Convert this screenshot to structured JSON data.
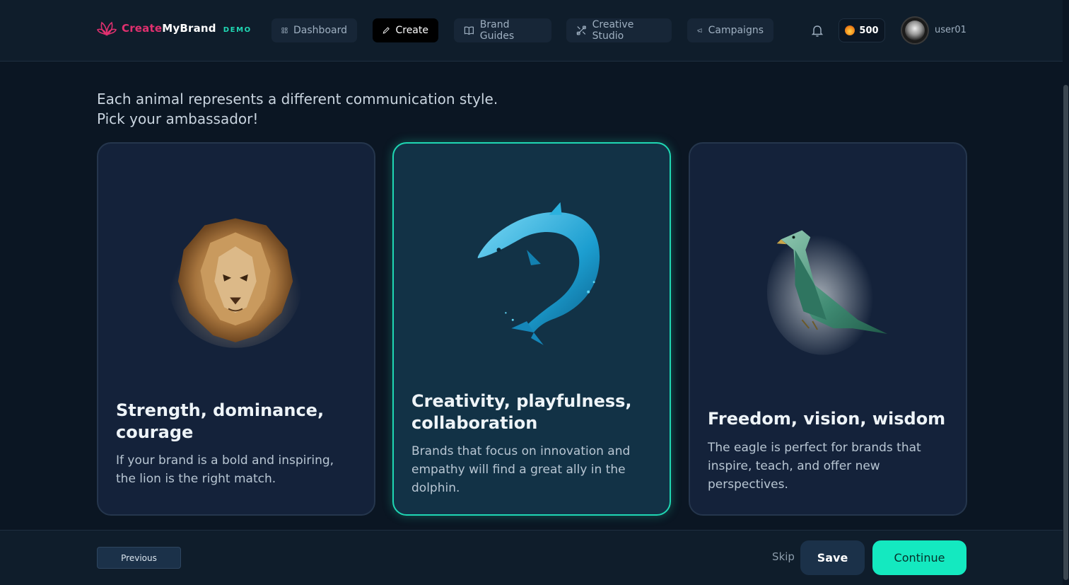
{
  "brand": {
    "name_part1": "Create",
    "name_part2": "MyBrand",
    "badge": "DEMO",
    "accent_color": "#e0306f",
    "badge_color": "#20d9b5"
  },
  "nav": {
    "items": [
      {
        "label": "Dashboard",
        "icon": "dashboard-icon",
        "active": false
      },
      {
        "label": "Create",
        "icon": "pen-icon",
        "active": true
      },
      {
        "label": "Brand Guides",
        "icon": "book-icon",
        "active": false
      },
      {
        "label": "Creative Studio",
        "icon": "tools-icon",
        "active": false
      },
      {
        "label": "Campaigns",
        "icon": "megaphone-icon",
        "active": false
      }
    ],
    "credits": "500",
    "username": "user01"
  },
  "intro": {
    "line1": "Each animal represents a different communication style.",
    "line2": "Pick your ambassador!"
  },
  "cards": [
    {
      "animal": "lion",
      "title": "Strength, dominance, courage",
      "description": "If your brand is a bold and inspiring, the lion is the right match.",
      "selected": false
    },
    {
      "animal": "dolphin",
      "title": "Creativity, playfulness, collaboration",
      "description": "Brands that focus on innovation and empathy will find a great ally in the dolphin.",
      "selected": true
    },
    {
      "animal": "eagle",
      "title": "Freedom, vision, wisdom",
      "description": "The eagle is perfect for brands that inspire, teach, and offer new perspectives.",
      "selected": false
    }
  ],
  "footer": {
    "previous": "Previous",
    "skip": "Skip",
    "save": "Save",
    "continue": "Continue",
    "continue_color": "#14e9c0"
  }
}
